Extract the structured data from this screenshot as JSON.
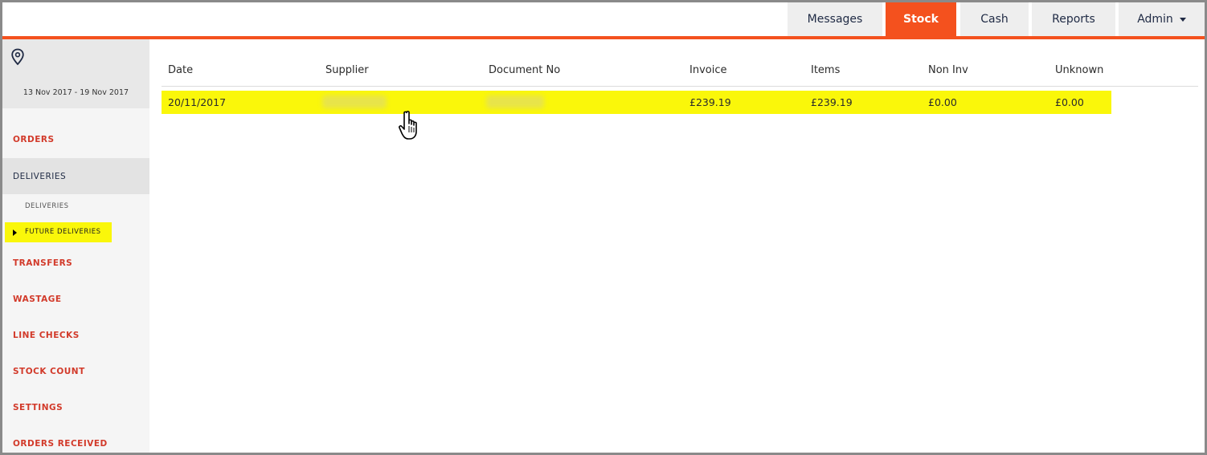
{
  "nav": {
    "tabs": [
      {
        "label": "Messages"
      },
      {
        "label": "Stock"
      },
      {
        "label": "Cash"
      },
      {
        "label": "Reports"
      },
      {
        "label": "Admin"
      }
    ],
    "accent": "#f4511e"
  },
  "sidebar": {
    "date_range": "13 Nov 2017 - 19 Nov 2017",
    "items": [
      {
        "label": "ORDERS"
      },
      {
        "label": "DELIVERIES"
      },
      {
        "label": "TRANSFERS"
      },
      {
        "label": "WASTAGE"
      },
      {
        "label": "LINE CHECKS"
      },
      {
        "label": "STOCK COUNT"
      },
      {
        "label": "SETTINGS"
      },
      {
        "label": "ORDERS RECEIVED"
      }
    ],
    "sub_items": [
      {
        "label": "DELIVERIES"
      },
      {
        "label": "FUTURE DELIVERIES"
      }
    ]
  },
  "table": {
    "columns": [
      "Date",
      "Supplier",
      "Document No",
      "Invoice",
      "Items",
      "Non Inv",
      "Unknown"
    ],
    "rows": [
      {
        "date": "20/11/2017",
        "supplier": "",
        "document_no": "",
        "invoice": "£239.19",
        "items": "£239.19",
        "non_inv": "£0.00",
        "unknown": "£0.00"
      }
    ]
  },
  "icons": {
    "location": "map-pin-icon",
    "cursor": "hand-pointer-icon"
  },
  "highlight_color": "#faf70a"
}
